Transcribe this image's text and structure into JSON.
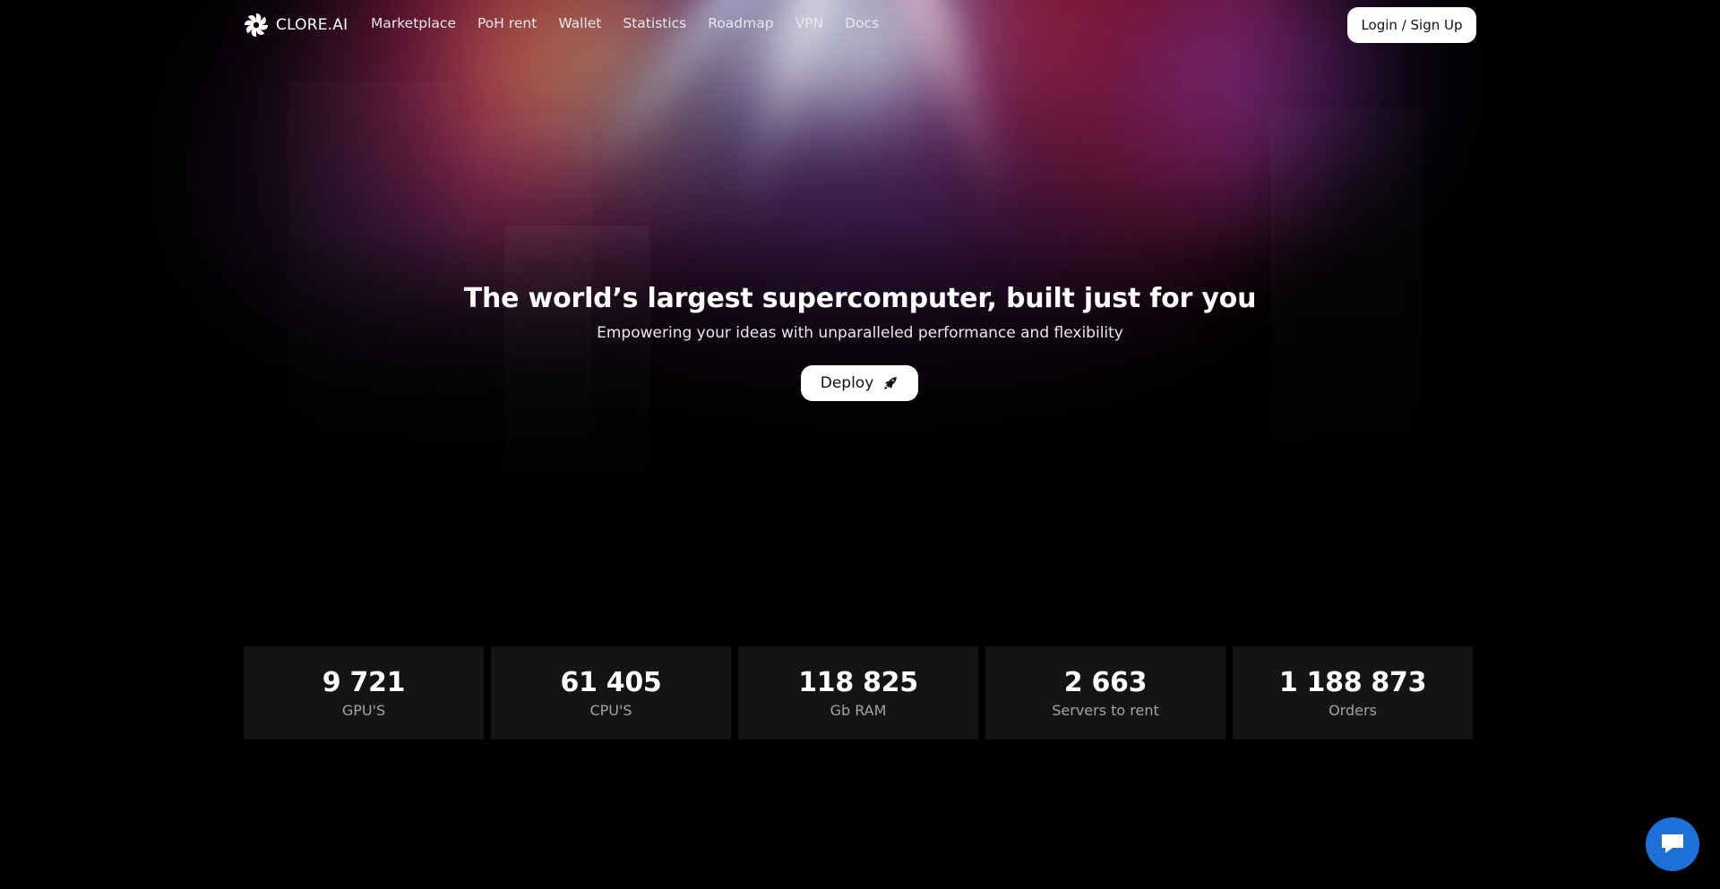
{
  "brand": {
    "name": "CLORE.AI",
    "logo_icon": "clore-swirl-logo-icon"
  },
  "nav": {
    "items": [
      {
        "label": "Marketplace"
      },
      {
        "label": "PoH rent"
      },
      {
        "label": "Wallet"
      },
      {
        "label": "Statistics"
      },
      {
        "label": "Roadmap"
      },
      {
        "label": "VPN"
      },
      {
        "label": "Docs"
      }
    ],
    "login_label": "Login / Sign Up"
  },
  "hero": {
    "title": "The world’s largest supercomputer, built just for you",
    "subtitle": "Empowering your ideas with unparalleled performance and flexibility",
    "cta_label": "Deploy",
    "cta_icon": "rocket-icon"
  },
  "stats": [
    {
      "value": "9 721",
      "label": "GPU'S"
    },
    {
      "value": "61 405",
      "label": "CPU'S"
    },
    {
      "value": "118 825",
      "label": "Gb RAM"
    },
    {
      "value": "2 663",
      "label": "Servers to rent"
    },
    {
      "value": "1 188 873",
      "label": "Orders"
    }
  ],
  "chat_widget": {
    "icon": "chat-bubble-icon",
    "color": "#1f6fd9"
  }
}
